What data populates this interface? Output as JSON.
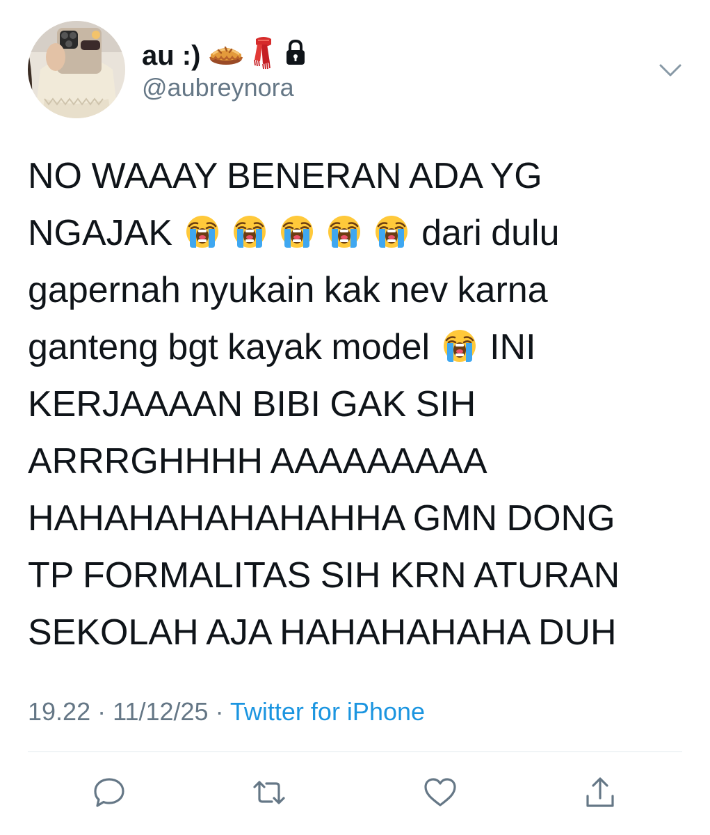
{
  "user": {
    "display_name": "au :)",
    "handle": "@aubreynora",
    "name_icons": [
      "pie-emoji",
      "scarf-emoji",
      "lock-icon"
    ]
  },
  "tweet": {
    "lines": [
      "NO WAAAY BENERAN ADA YG",
      "NGAJAK",
      "dari dulu",
      "gapernah nyukain kak nev karna",
      "ganteng bgt kayak model",
      "INI",
      "KERJAAAAN BIBI GAK SIH",
      "ARRRGHHHH AAAAAAAAA",
      "HAHAHAHAHAHAHHA GMN DONG",
      "TP FORMALITAS SIH KRN ATURAN",
      "SEKOLAH AJA HAHAHAHAHA DUH"
    ],
    "emoji": "loudly-crying-face"
  },
  "meta": {
    "time": "19.22",
    "separator": " · ",
    "date": "11/12/25",
    "source": "Twitter for iPhone"
  },
  "actions": [
    "reply-icon",
    "retweet-icon",
    "like-icon",
    "share-icon"
  ],
  "colors": {
    "text": "#0f1419",
    "secondary": "#657786",
    "link": "#1b95e0",
    "divider": "#e1e8ed"
  }
}
